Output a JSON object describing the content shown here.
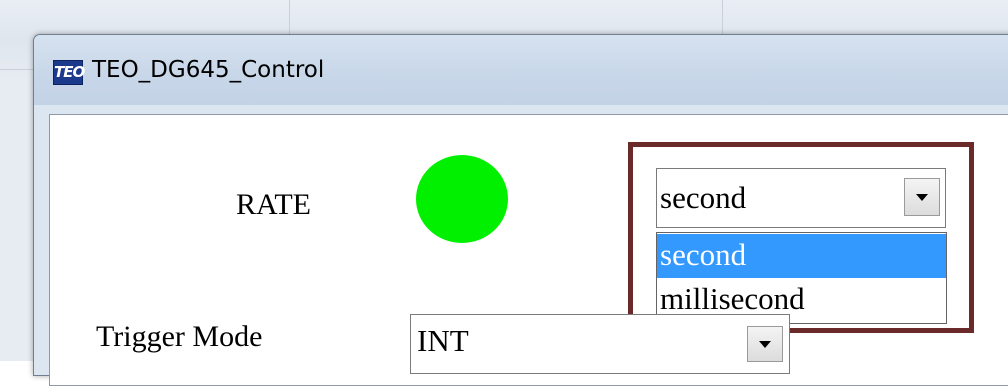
{
  "window": {
    "title": "TEO_DG645_Control",
    "icon_text": "TEO"
  },
  "rate": {
    "label": "RATE",
    "indicator_color": "#00f000",
    "unit_combo": {
      "value": "second",
      "options": [
        "second",
        "millisecond"
      ],
      "highlighted_option": "second"
    }
  },
  "trigger": {
    "label": "Trigger Mode",
    "value": "INT"
  },
  "colors": {
    "selection": "#3399ff",
    "annotation_border": "#6b2a2a"
  }
}
